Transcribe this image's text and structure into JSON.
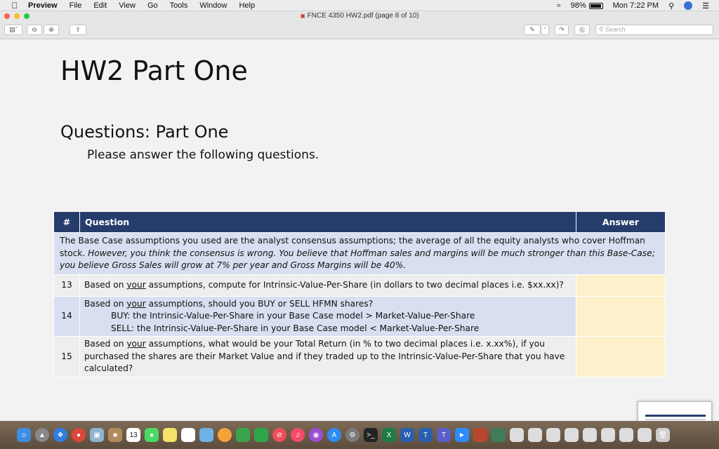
{
  "menubar": {
    "app": "Preview",
    "items": [
      "File",
      "Edit",
      "View",
      "Go",
      "Tools",
      "Window",
      "Help"
    ],
    "battery": "98%",
    "clock": "Mon 7:22 PM"
  },
  "window": {
    "title": "FNCE 4350 HW2.pdf (page 8 of 10)",
    "search_placeholder": "Search"
  },
  "doc": {
    "title": "HW2 Part One",
    "section": "Questions: Part One",
    "instruction": "Please answer the following questions.",
    "table": {
      "headers": {
        "num": "#",
        "question": "Question",
        "answer": "Answer"
      },
      "intro_plain": "The Base Case assumptions you used are the analyst consensus assumptions; the average of all the equity analysts who cover Hoffman stock.",
      "intro_italic": "However, you think the consensus is wrong.  You believe that Hoffman sales and margins will be much stronger than this Base-Case; you believe Gross Sales will grow at 7% per year and Gross Margins will be 40%.",
      "rows": [
        {
          "num": "13",
          "pre": "Based on ",
          "u": "your",
          "post": " assumptions, compute for Intrinsic-Value-Per-Share (in dollars to two decimal places i.e. $xx.xx)?"
        },
        {
          "num": "14",
          "pre": "Based on ",
          "u": "your",
          "post": " assumptions, should you BUY or SELL HFMN shares?",
          "line2": "BUY: the Intrinsic-Value-Per-Share in your Base Case model > Market-Value-Per-Share",
          "line3": "SELL: the Intrinsic-Value-Per-Share in your Base Case model < Market-Value-Per-Share"
        },
        {
          "num": "15",
          "pre": "Based on ",
          "u": "your",
          "post": " assumptions, what would be your Total Return (in % to two decimal places i.e. x.xx%), if you purchased the shares are their Market Value and if they traded up to the Intrinsic-Value-Per-Share that you have calculated?"
        }
      ]
    }
  },
  "dock": {
    "calendar_day": "13"
  },
  "colors": {
    "header": "#263d6c",
    "row_blue": "#d8dff0",
    "answer_cell": "#fdf1cc"
  }
}
